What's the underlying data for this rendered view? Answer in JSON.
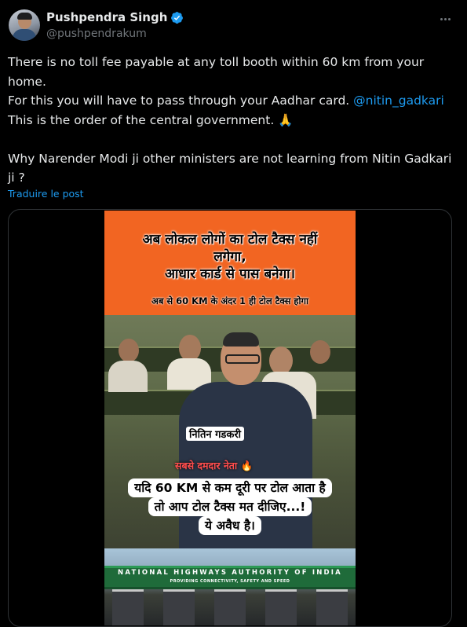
{
  "author": {
    "display_name": "Pushpendra Singh",
    "handle": "@pushpendrakum",
    "verified": true
  },
  "menu_icon": "more-horizontal-icon",
  "tweet": {
    "line1": "There is no toll fee payable at any toll booth within 60 km from your home.",
    "line2_prefix": "For this you will have to pass through your Aadhar card. ",
    "line2_mention": "@nitin_gadkari",
    "line3": "This is the order of the central government. 🙏",
    "line4": "Why Narender Modi ji other ministers are not learning from Nitin Gadkari ji ?"
  },
  "translate_label": "Traduire le post",
  "media": {
    "banner_line1": "अब लोकल लोगों का टोल टैक्स नहीं",
    "banner_line2": "लगेगा,",
    "banner_line3": "आधार कार्ड से पास बनेगा।",
    "banner_sub": "अब से 60 KM के अंदर 1 ही टोल टैक्स होगा",
    "name_caption": "नितिन गडकरी",
    "tag_caption": "सबसे दमदार नेता 🔥",
    "speech_line1": "यदि 60 KM से कम दूरी पर टोल आता है",
    "speech_line2": "तो आप टोल टैक्स मत दीजिए...!",
    "speech_line3": "ये अवैध है।",
    "sign_title": "NATIONAL HIGHWAYS AUTHORITY OF INDIA",
    "sign_subtitle": "PROVIDING CONNECTIVITY, SAFETY AND SPEED"
  },
  "colors": {
    "background": "#000000",
    "text": "#e7e9ea",
    "muted": "#71767b",
    "link": "#1d9bf0",
    "banner": "#f26522"
  }
}
